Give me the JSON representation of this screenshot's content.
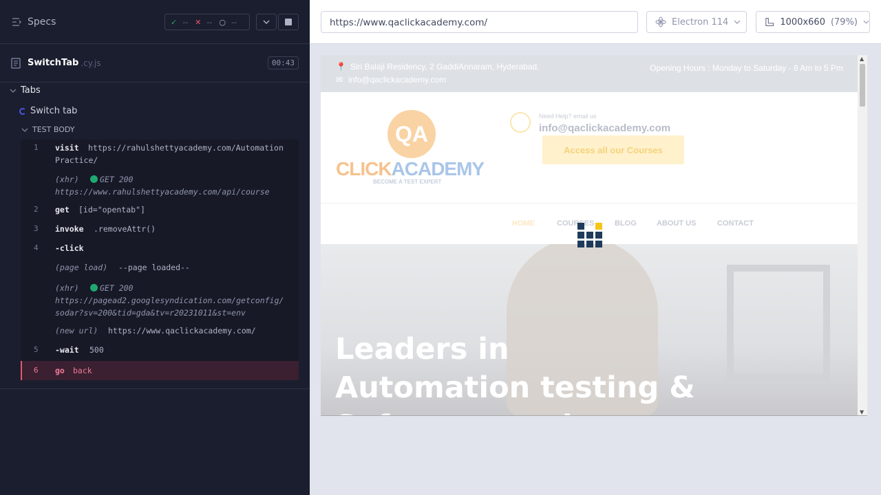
{
  "reporter": {
    "specs_label": "Specs",
    "stats": {
      "passed": "--",
      "failed": "--",
      "pending": "--"
    },
    "spec": {
      "name": "SwitchTab",
      "ext": ".cy.js",
      "duration": "00:43"
    },
    "suite_title": "Tabs",
    "test_title": "Switch tab",
    "test_body_label": "TEST BODY",
    "commands": [
      {
        "num": "1",
        "name": "visit",
        "message": "https://rahulshettyacademy.com/Automation",
        "message_cont": "Practice/"
      },
      {
        "num": "",
        "name": "(xhr)",
        "message": "GET 200",
        "message_cont": "https://www.rahulshettyacademy.com/api/course"
      },
      {
        "num": "2",
        "name": "get",
        "message": "[id=\"opentab\"]"
      },
      {
        "num": "3",
        "name": "invoke",
        "message": ".removeAttr()"
      },
      {
        "num": "4",
        "name": "-click",
        "message": ""
      },
      {
        "num": "",
        "name": "(page load)",
        "message": "--page loaded--"
      },
      {
        "num": "",
        "name": "(xhr)",
        "message": "GET 200",
        "message_cont": "https://pagead2.googlesyndication.com/getconfig/",
        "message_cont2": "sodar?sv=200&tid=gda&tv=r20231011&st=env"
      },
      {
        "num": "",
        "name": "(new url)",
        "message": "https://www.qaclickacademy.com/"
      },
      {
        "num": "5",
        "name": "-wait",
        "message": "500"
      },
      {
        "num": "6",
        "name": "go",
        "message": "back"
      }
    ]
  },
  "aut": {
    "url": "https://www.qaclickacademy.com/",
    "browser": "Electron 114",
    "viewport": "1000x660",
    "scale": "(79%)"
  },
  "site": {
    "address": "Siri Balaji Residency, 2 GaddiAnnaram, Hyderabad.",
    "email_top": "info@qaclickacademy.com",
    "hours": "Opening Hours : Monday to Saturday - 8 Am to 5 Pm",
    "logo_qa": "QA",
    "logo_click": "CLICK",
    "logo_academy": "ACADEMY",
    "logo_tag": "BECOME A TEST EXPERT",
    "help_label": "Need Help? email us",
    "help_email": "info@qaclickacademy.com",
    "access_button": "Access all our Courses",
    "nav": [
      "HOME",
      "COURSES",
      "BLOG",
      "ABOUT US",
      "CONTACT"
    ],
    "hero_line1": "Leaders in",
    "hero_line2": "Automation testing &",
    "hero_line3": "Software testing"
  }
}
